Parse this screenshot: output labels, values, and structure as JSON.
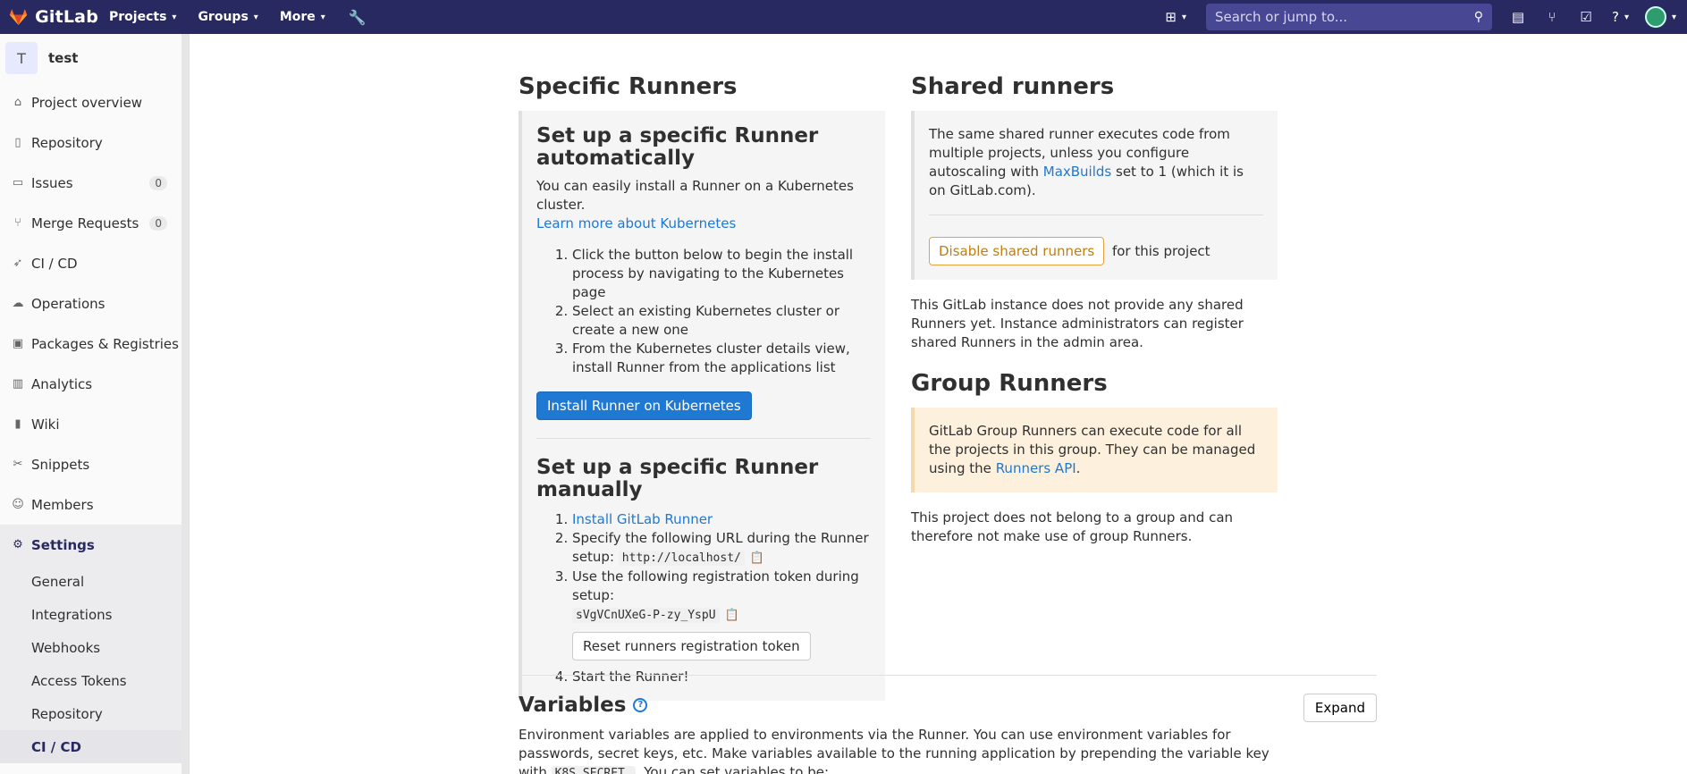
{
  "topbar": {
    "brand": "GitLab",
    "nav": [
      "Projects",
      "Groups",
      "More"
    ],
    "search_placeholder": "Search or jump to...",
    "colors": {
      "bg": "#292961",
      "search_bg": "#474793"
    }
  },
  "sidebar": {
    "project_initial": "T",
    "project_name": "test",
    "items": [
      {
        "label": "Project overview",
        "icon": "home-icon"
      },
      {
        "label": "Repository",
        "icon": "doc-icon"
      },
      {
        "label": "Issues",
        "icon": "issues-icon",
        "badge": "0"
      },
      {
        "label": "Merge Requests",
        "icon": "merge-icon",
        "badge": "0"
      },
      {
        "label": "CI / CD",
        "icon": "rocket-icon"
      },
      {
        "label": "Operations",
        "icon": "cloud-icon"
      },
      {
        "label": "Packages & Registries",
        "icon": "package-icon"
      },
      {
        "label": "Analytics",
        "icon": "chart-icon"
      },
      {
        "label": "Wiki",
        "icon": "book-icon"
      },
      {
        "label": "Snippets",
        "icon": "scissors-icon"
      },
      {
        "label": "Members",
        "icon": "users-icon"
      },
      {
        "label": "Settings",
        "icon": "gear-icon"
      }
    ],
    "settings_sub": [
      "General",
      "Integrations",
      "Webhooks",
      "Access Tokens",
      "Repository",
      "CI / CD"
    ]
  },
  "specific": {
    "title": "Specific Runners",
    "auto_title": "Set up a specific Runner automatically",
    "auto_text": "You can easily install a Runner on a Kubernetes cluster.",
    "auto_link": "Learn more about Kubernetes",
    "auto_steps": [
      "Click the button below to begin the install process by navigating to the Kubernetes page",
      "Select an existing Kubernetes cluster or create a new one",
      "From the Kubernetes cluster details view, install Runner from the applications list"
    ],
    "install_button": "Install Runner on Kubernetes",
    "manual_title": "Set up a specific Runner manually",
    "manual_link": "Install GitLab Runner",
    "step2_text": "Specify the following URL during the Runner setup:",
    "url": "http://localhost/",
    "step3_text": "Use the following registration token during setup:",
    "token": "sVgVCnUXeG-P-zy_YspU",
    "reset_button": "Reset runners registration token",
    "step4_text": "Start the Runner!"
  },
  "shared": {
    "title": "Shared runners",
    "text_pre": "The same shared runner executes code from multiple projects, unless you configure autoscaling with",
    "link": "MaxBuilds",
    "text_post": "set to 1 (which it is on GitLab.com).",
    "disable_button": "Disable shared runners",
    "for_project": "for this project",
    "none_text": "This GitLab instance does not provide any shared Runners yet. Instance administrators can register shared Runners in the admin area."
  },
  "group": {
    "title": "Group Runners",
    "text_pre": "GitLab Group Runners can execute code for all the projects in this group. They can be managed using the",
    "link": "Runners API",
    "text_post": ".",
    "note": "This project does not belong to a group and can therefore not make use of group Runners."
  },
  "variables": {
    "title": "Variables",
    "expand": "Expand",
    "text_pre": "Environment variables are applied to environments via the Runner. You can use environment variables for passwords, secret keys, etc. Make variables available to the running application by prepending the variable key with",
    "code": "K8S_SECRET_",
    "text_post": ". You can set variables to be:"
  }
}
